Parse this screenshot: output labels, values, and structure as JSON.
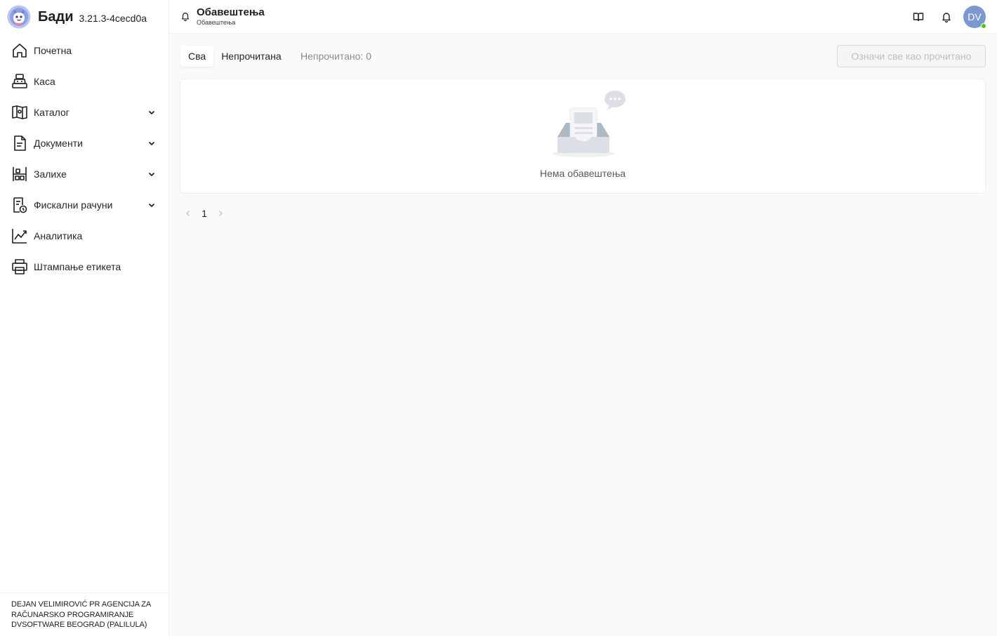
{
  "brand": {
    "name": "Бади",
    "version": "3.21.3-4cecd0a"
  },
  "sidebar": {
    "items": [
      {
        "label": "Почетна"
      },
      {
        "label": "Каса"
      },
      {
        "label": "Каталог"
      },
      {
        "label": "Документи"
      },
      {
        "label": "Залихе"
      },
      {
        "label": "Фискални рачуни"
      },
      {
        "label": "Аналитика"
      },
      {
        "label": "Штампање етикета"
      }
    ],
    "company": "DEJAN VELIMIROVIĆ PR AGENCIJA ZA RAČUNARSKO PROGRAMIRANJE DVSOFTWARE BEOGRAD (PALILULA)"
  },
  "header": {
    "title": "Обавештења",
    "subtitle": "Обавештења",
    "avatar_initials": "DV"
  },
  "filters": {
    "all_label": "Сва",
    "unread_label": "Непрочитана",
    "unread_count_text": "Непрочитано: 0"
  },
  "actions": {
    "mark_all_read": "Означи све као прочитано"
  },
  "empty": {
    "text": "Нема обавештења"
  },
  "pagination": {
    "current_page": "1"
  },
  "colors": {
    "accent": "#7d97d1",
    "online": "#52c41a",
    "disabled_text": "#bfbfbf"
  }
}
